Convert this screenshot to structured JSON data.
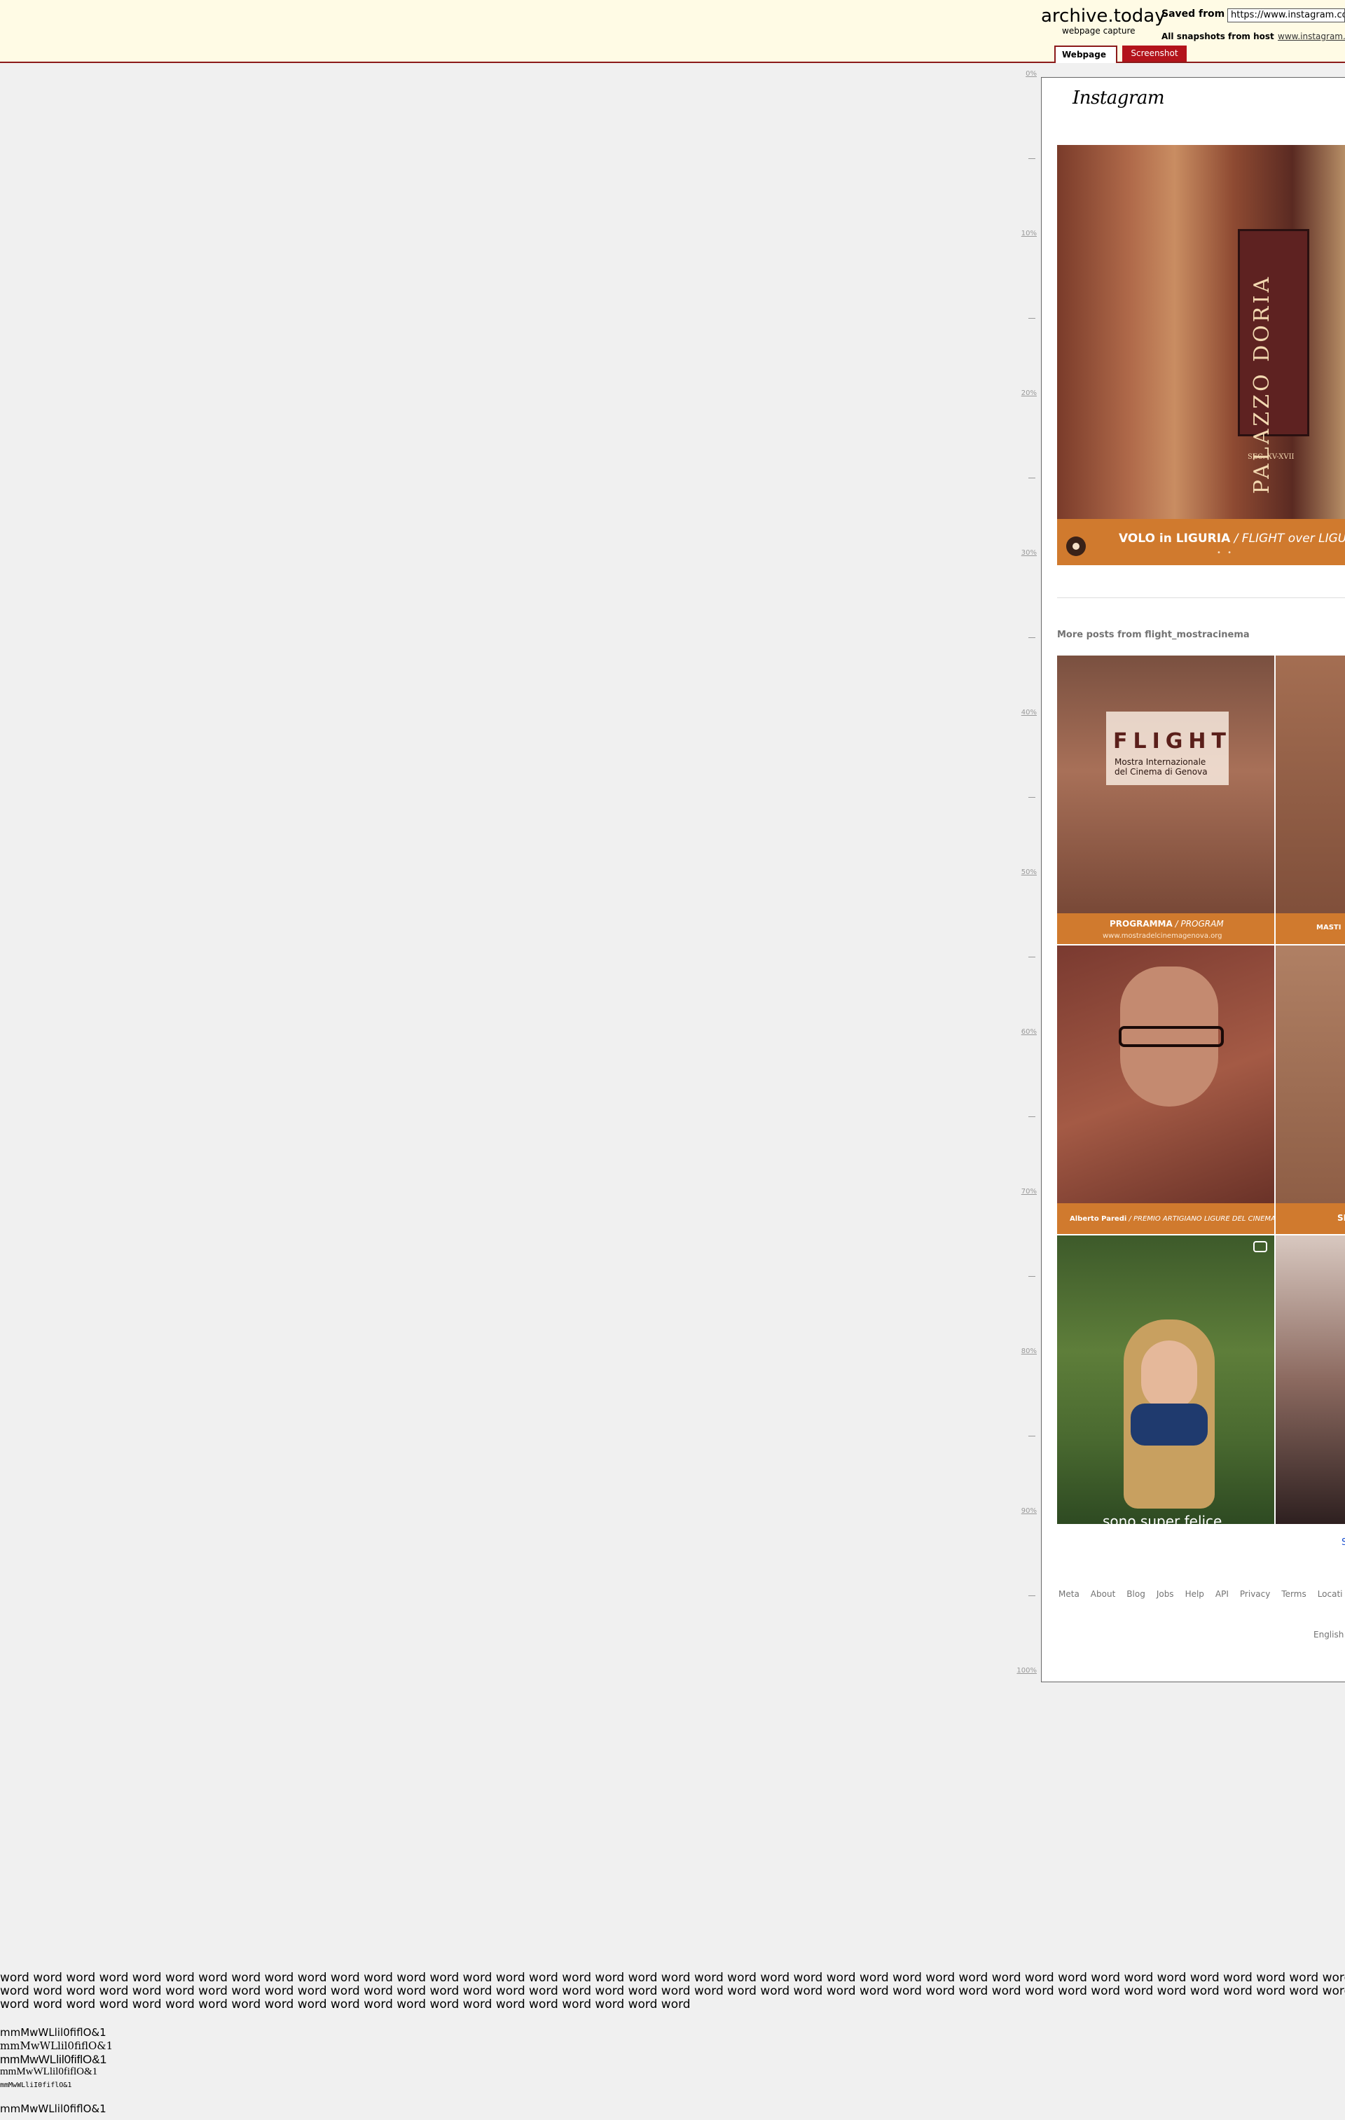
{
  "archive": {
    "brand": "archive.today",
    "subtitle": "webpage capture",
    "saved_from_label": "Saved from",
    "saved_url": "https://www.instagram.co",
    "snapshots_label": "All snapshots from host",
    "snapshots_host": "www.instagram.",
    "tabs": [
      "Webpage",
      "Screenshot"
    ]
  },
  "ruler": [
    "0%",
    "10%",
    "20%",
    "30%",
    "40%",
    "50%",
    "60%",
    "70%",
    "80%",
    "90%",
    "100%"
  ],
  "instagram": {
    "logo": "Instagram",
    "post": {
      "sign_text": "PALAZZO DORIA",
      "sign_date": "SEC. XV-XVII",
      "caption_bold": "VOLO in LIGURIA",
      "caption_italic": " / FLIGHT over LIGURIA",
      "dots": "• •"
    },
    "more_posts_title": "More posts from flight_mostracinema",
    "thumbs": {
      "t1_title": "FLIGHT",
      "t1_subtitle": "Mostra Internazionale\ndel Cinema di Genova",
      "t1_caption_bold": "PROGRAMMA",
      "t1_caption_italic": " / PROGRAM",
      "t1_url": "www.mostradelcinemagenova.org",
      "t2_caption": "MASTI",
      "t3_caption_bold": "Alberto Paredi",
      "t3_caption_rest": " / PREMIO ARTIGIANO LIGURE DEL CINEMA",
      "t4_caption": "SI",
      "t5_subtitle": "sono super felice"
    },
    "see_more": "S",
    "footer_links": [
      "Meta",
      "About",
      "Blog",
      "Jobs",
      "Help",
      "API",
      "Privacy",
      "Terms",
      "Locati"
    ],
    "language": "English"
  },
  "font_test": {
    "words": "word word word word word word word word word word word word word word word word word word word word word word word word word word word word word word word word word word word word word word word word word word word word w\nword word word word word word word word word word word word word word word word word word word word word word word word word word word word word word word word word word word word word word word word word word word word word w\nword word word word word word word word word word word word word word word word word word word word word",
    "lines": [
      "mmMwWLlil0fiflO&1",
      "mmMwWLlil0fiflO&1",
      "mmMwWLlil0fiflO&1",
      "mmMwWLlil0fiflO&1",
      "mmMwWLliI0fiflO&1",
      "mmMwWLlil0fiflO&1"
    ]
  }
}
